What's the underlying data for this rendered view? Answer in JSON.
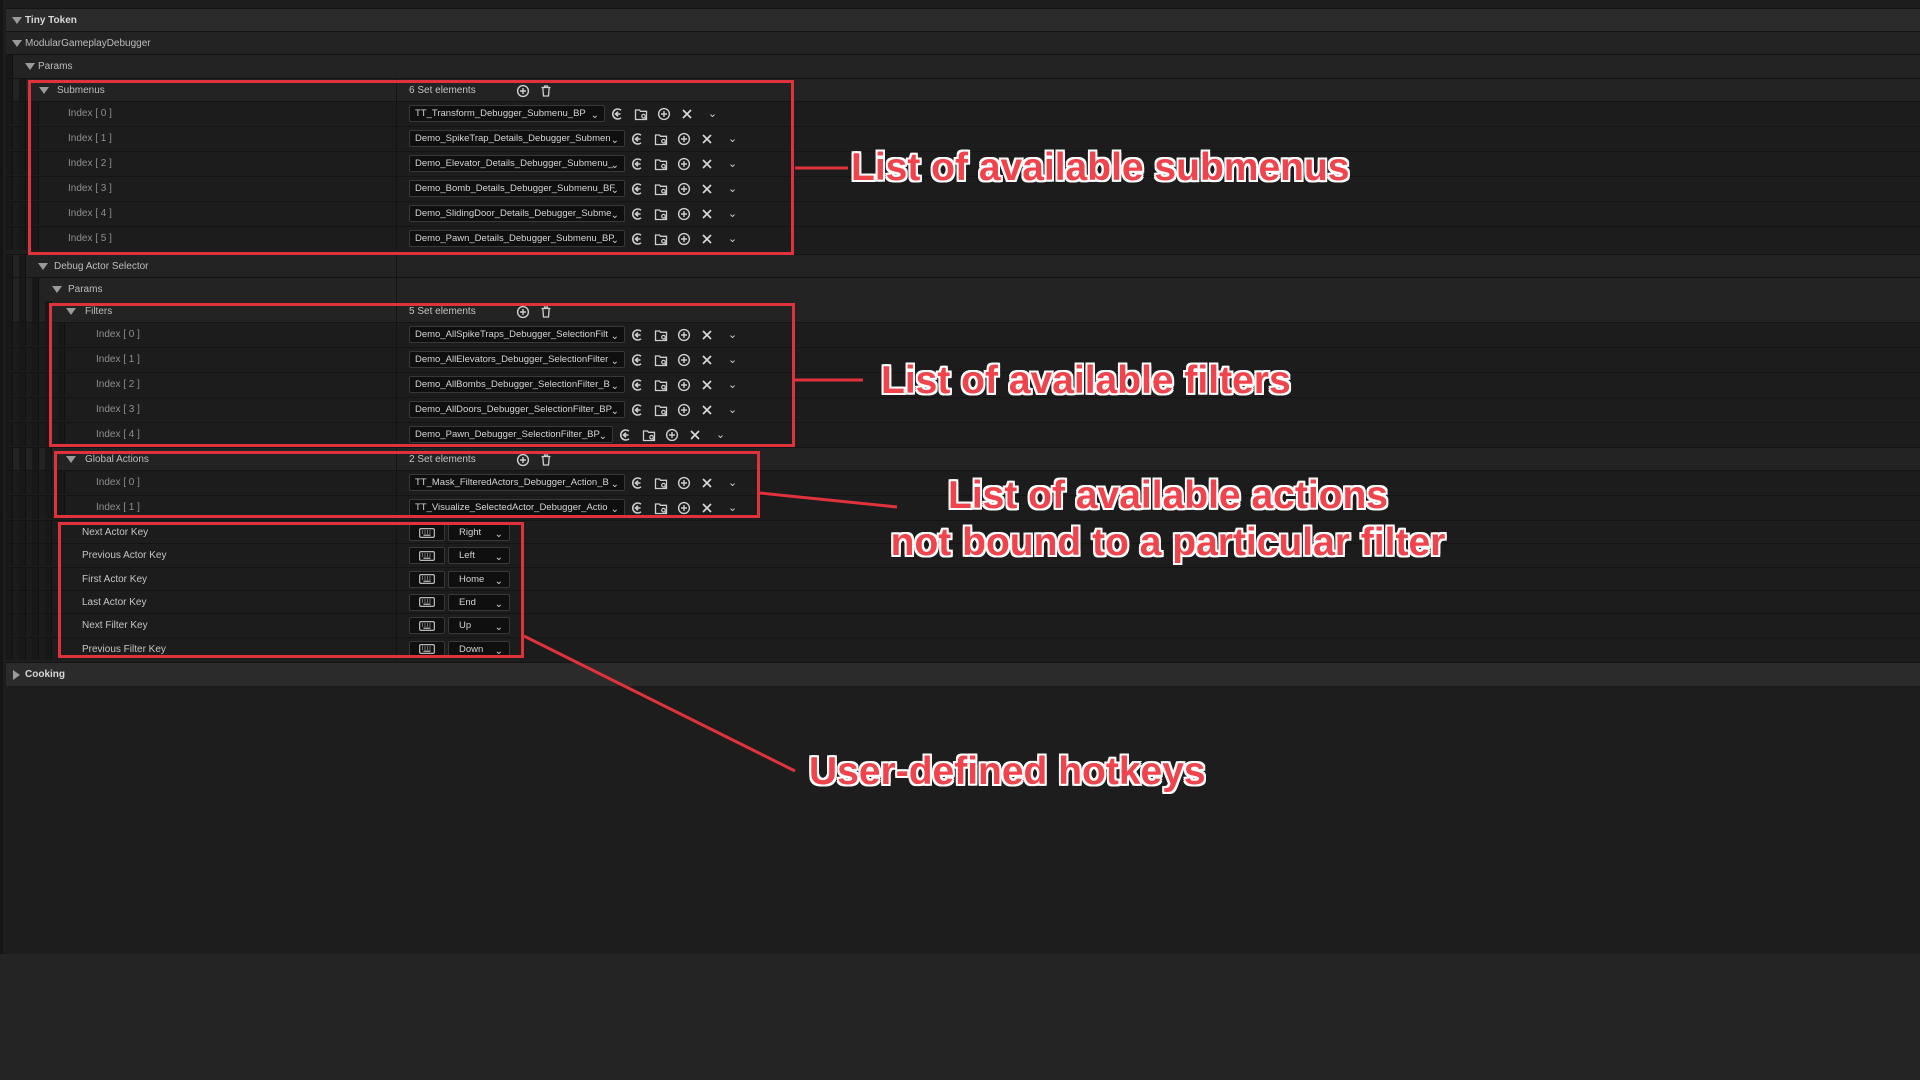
{
  "tree": {
    "tiny_token": "Tiny Token",
    "modular": "ModularGameplayDebugger",
    "params": "Params",
    "submenus": {
      "label": "Submenus",
      "summary": "6 Set elements"
    },
    "submenu_items": [
      {
        "index": "Index [ 0 ]",
        "value": "TT_Transform_Debugger_Submenu_BP"
      },
      {
        "index": "Index [ 1 ]",
        "value": "Demo_SpikeTrap_Details_Debugger_Submen"
      },
      {
        "index": "Index [ 2 ]",
        "value": "Demo_Elevator_Details_Debugger_Submenu_"
      },
      {
        "index": "Index [ 3 ]",
        "value": "Demo_Bomb_Details_Debugger_Submenu_BF"
      },
      {
        "index": "Index [ 4 ]",
        "value": "Demo_SlidingDoor_Details_Debugger_Subme"
      },
      {
        "index": "Index [ 5 ]",
        "value": "Demo_Pawn_Details_Debugger_Submenu_BP"
      }
    ],
    "debug_actor_selector": "Debug Actor Selector",
    "params2": "Params",
    "filters": {
      "label": "Filters",
      "summary": "5 Set elements"
    },
    "filter_items": [
      {
        "index": "Index [ 0 ]",
        "value": "Demo_AllSpikeTraps_Debugger_SelectionFilt"
      },
      {
        "index": "Index [ 1 ]",
        "value": "Demo_AllElevators_Debugger_SelectionFilter"
      },
      {
        "index": "Index [ 2 ]",
        "value": "Demo_AllBombs_Debugger_SelectionFilter_B"
      },
      {
        "index": "Index [ 3 ]",
        "value": "Demo_AllDoors_Debugger_SelectionFilter_BP"
      },
      {
        "index": "Index [ 4 ]",
        "value": "Demo_Pawn_Debugger_SelectionFilter_BP"
      }
    ],
    "global_actions": {
      "label": "Global Actions",
      "summary": "2 Set elements"
    },
    "action_items": [
      {
        "index": "Index [ 0 ]",
        "value": "TT_Mask_FilteredActors_Debugger_Action_B"
      },
      {
        "index": "Index [ 1 ]",
        "value": "TT_Visualize_SelectedActor_Debugger_Actio"
      }
    ],
    "hotkeys": [
      {
        "label": "Next Actor Key",
        "key": "Right"
      },
      {
        "label": "Previous Actor Key",
        "key": "Left"
      },
      {
        "label": "First Actor Key",
        "key": "Home"
      },
      {
        "label": "Last Actor Key",
        "key": "End"
      },
      {
        "label": "Next Filter Key",
        "key": "Up"
      },
      {
        "label": "Previous Filter Key",
        "key": "Down"
      }
    ],
    "cooking": "Cooking"
  },
  "annotations": {
    "submenus": "List of available submenus",
    "filters": "List of available filters",
    "actions_line1": "List of available actions",
    "actions_line2": "not bound to a particular filter",
    "hotkeys": "User-defined hotkeys"
  },
  "colors": {
    "annotation_red": "#e0323b",
    "panel_bg": "#1d1d1d"
  },
  "icons": [
    "expand-arrow-icon",
    "collapse-arrow-icon",
    "add-element-icon",
    "delete-all-icon",
    "use-selected-icon",
    "browse-icon",
    "insert-icon",
    "remove-icon",
    "dropdown-chevron-icon",
    "keyboard-icon"
  ]
}
